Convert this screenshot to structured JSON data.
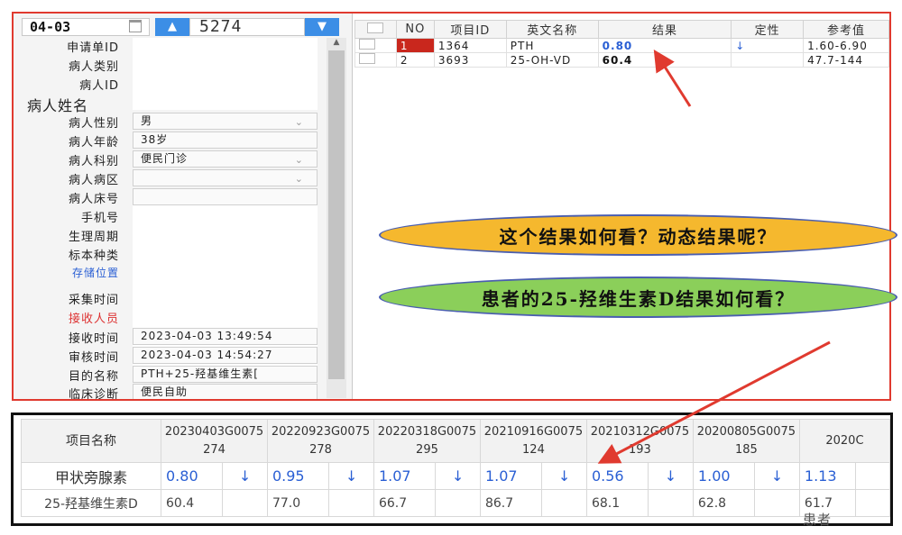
{
  "header": {
    "date": "04-03",
    "up_label": "^",
    "down_label": "v",
    "sample_no": "5274"
  },
  "form": {
    "fields": [
      {
        "label": "申请单ID",
        "value": ""
      },
      {
        "label": "病人类别",
        "value": ""
      },
      {
        "label": "病人ID",
        "value": ""
      },
      {
        "label": "病人姓名",
        "value": ""
      },
      {
        "label": "病人性别",
        "value": "男"
      },
      {
        "label": "病人年龄",
        "value": "38岁"
      },
      {
        "label": "病人科别",
        "value": "便民门诊"
      },
      {
        "label": "病人病区",
        "value": ""
      },
      {
        "label": "病人床号",
        "value": ""
      },
      {
        "label": "手机号",
        "value": ""
      },
      {
        "label": "生理周期",
        "value": ""
      },
      {
        "label": "标本种类",
        "value": ""
      },
      {
        "label": "存储位置",
        "value": ""
      },
      {
        "label": "采集时间",
        "value": ""
      },
      {
        "label": "接收人员",
        "value": ""
      },
      {
        "label": "接收时间",
        "value": "2023-04-03 13:49:54"
      },
      {
        "label": "审核时间",
        "value": "2023-04-03 14:54:27"
      },
      {
        "label": "目的名称",
        "value": "PTH+25-羟基维生素["
      },
      {
        "label": "临床诊断",
        "value": "便民自助"
      }
    ]
  },
  "results": {
    "columns": [
      "NO",
      "项目ID",
      "英文名称",
      "结果",
      "定性",
      "参考值"
    ],
    "rows": [
      {
        "no": "1",
        "id": "1364",
        "name": "PTH",
        "result": "0.80",
        "flag": "↓",
        "ref": "1.60-6.90"
      },
      {
        "no": "2",
        "id": "3693",
        "name": "25-OH-VD",
        "result": "60.4",
        "flag": "",
        "ref": "47.7-144"
      }
    ]
  },
  "callouts": {
    "q1": "这个结果如何看？动态结果呢？",
    "q2": "患者的25-羟维生素D结果如何看？"
  },
  "history": {
    "name_header": "项目名称",
    "columns": [
      {
        "line1": "20230403G0075",
        "line2": "274"
      },
      {
        "line1": "20220923G0075",
        "line2": "278"
      },
      {
        "line1": "20220318G0075",
        "line2": "295"
      },
      {
        "line1": "20210916G0075",
        "line2": "124"
      },
      {
        "line1": "20210312G0075",
        "line2": "193"
      },
      {
        "line1": "20200805G0075",
        "line2": "185"
      },
      {
        "line1": "2020C",
        "line2": ""
      }
    ],
    "rows": [
      {
        "name": "甲状旁腺素",
        "cells": [
          {
            "v": "0.80",
            "a": "↓"
          },
          {
            "v": "0.95",
            "a": "↓"
          },
          {
            "v": "1.07",
            "a": "↓"
          },
          {
            "v": "1.07",
            "a": "↓"
          },
          {
            "v": "0.56",
            "a": "↓"
          },
          {
            "v": "1.00",
            "a": "↓"
          },
          {
            "v": "1.13",
            "a": ""
          }
        ]
      },
      {
        "name": "25-羟基维生素D",
        "cells": [
          {
            "v": "60.4",
            "a": ""
          },
          {
            "v": "77.0",
            "a": ""
          },
          {
            "v": "66.7",
            "a": ""
          },
          {
            "v": "86.7",
            "a": ""
          },
          {
            "v": "68.1",
            "a": ""
          },
          {
            "v": "62.8",
            "a": ""
          },
          {
            "v": "61.7",
            "a": ""
          }
        ]
      }
    ]
  },
  "watermark": "患者",
  "colors": {
    "frame_red": "#e03a2f",
    "accent_blue": "#3c8ee6",
    "bubble_yellow": "#f5b82e",
    "bubble_green": "#8bcf5a"
  }
}
